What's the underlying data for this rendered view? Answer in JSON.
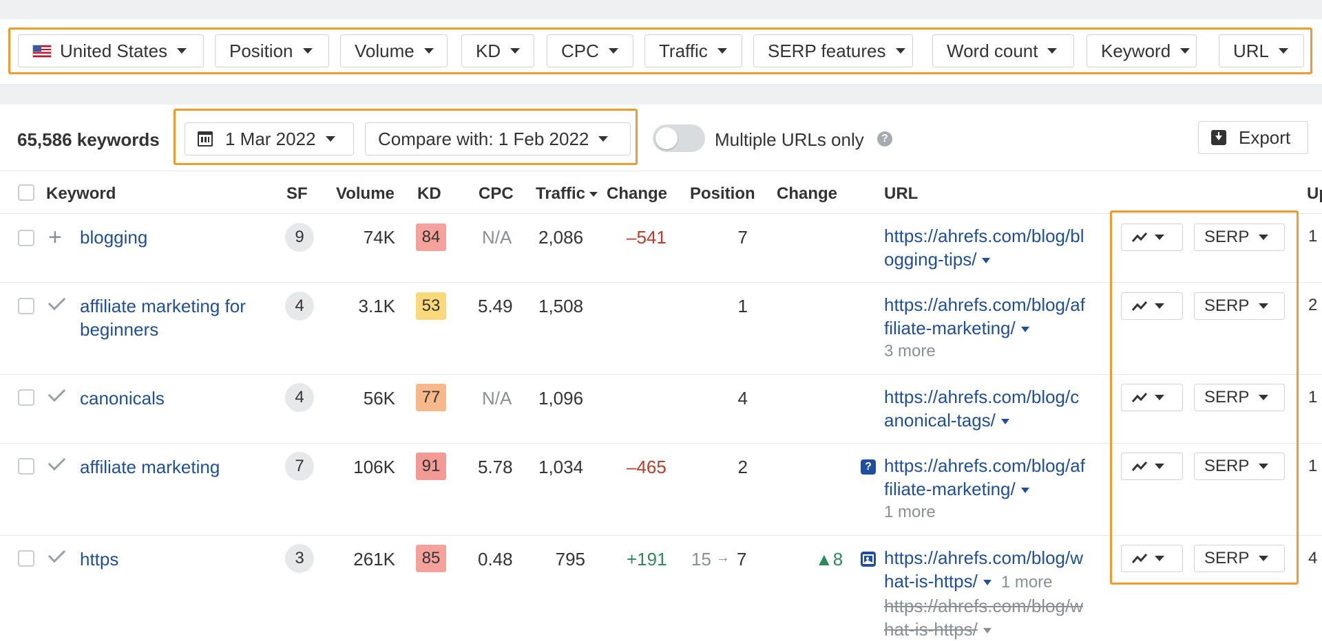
{
  "filters": {
    "country": "United States",
    "items": [
      "Position",
      "Volume",
      "KD",
      "CPC",
      "Traffic",
      "SERP features",
      "Word count",
      "Keyword",
      "URL"
    ]
  },
  "toolbar": {
    "keyword_count": "65,586 keywords",
    "date": "1 Mar 2022",
    "compare": "Compare with: 1 Feb 2022",
    "multiple_urls_label": "Multiple URLs only",
    "help": "?",
    "export_label": "Export"
  },
  "columns": {
    "keyword": "Keyword",
    "sf": "SF",
    "volume": "Volume",
    "kd": "KD",
    "cpc": "CPC",
    "traffic": "Traffic",
    "change": "Change",
    "position": "Position",
    "pos_change": "Change",
    "url": "URL",
    "up": "Up"
  },
  "rows": [
    {
      "keyword_line1": "blogging",
      "keyword_line2": "",
      "sf": "9",
      "volume": "74K",
      "kd": "84",
      "kd_color": "#f4a29b",
      "cpc": "N/A",
      "traffic": "2,086",
      "change": "–541",
      "position": "7",
      "pos_change": "",
      "url_line1": "https://ahrefs.com/blog/bl",
      "url_line2": "ogging-tips/",
      "more": "",
      "action_trend_icon": "trend-icon",
      "serp_label": "SERP",
      "up": "1"
    },
    {
      "keyword_line1": "affiliate marketing for",
      "keyword_line2": "beginners",
      "sf": "4",
      "volume": "3.1K",
      "kd": "53",
      "kd_color": "#fbd97a",
      "cpc": "5.49",
      "traffic": "1,508",
      "change": "",
      "position": "1",
      "pos_change": "",
      "url_line1": "https://ahrefs.com/blog/af",
      "url_line2": "filiate-marketing/",
      "more": "3 more",
      "action_trend_icon": "trend-icon",
      "serp_label": "SERP",
      "up": "2"
    },
    {
      "keyword_line1": "canonicals",
      "keyword_line2": "",
      "sf": "4",
      "volume": "56K",
      "kd": "77",
      "kd_color": "#f7b98a",
      "cpc": "N/A",
      "traffic": "1,096",
      "change": "",
      "position": "4",
      "pos_change": "",
      "url_line1": "https://ahrefs.com/blog/c",
      "url_line2": "anonical-tags/",
      "more": "",
      "action_trend_icon": "trend-icon",
      "serp_label": "SERP",
      "up": "1"
    },
    {
      "keyword_line1": "affiliate marketing",
      "keyword_line2": "",
      "sf": "7",
      "volume": "106K",
      "kd": "91",
      "kd_color": "#f29a93",
      "cpc": "5.78",
      "traffic": "1,034",
      "change": "–465",
      "position": "2",
      "pos_change": "",
      "url_line1": "https://ahrefs.com/blog/af",
      "url_line2": "filiate-marketing/",
      "more": "1 more",
      "action_trend_icon": "trend-icon",
      "serp_label": "SERP",
      "up": "1"
    },
    {
      "keyword_line1": "https",
      "keyword_line2": "",
      "sf": "3",
      "volume": "261K",
      "kd": "85",
      "kd_color": "#f4a29b",
      "cpc": "0.48",
      "traffic": "795",
      "change": "+191",
      "position_prev": "15",
      "position_arrow": "→",
      "position": "7",
      "pos_change": "▲8",
      "url_line1": "https://ahrefs.com/blog/w",
      "url_line2": "hat-is-https/",
      "more": "1 more",
      "old_url_line1": "https://ahrefs.com/blog/w",
      "old_url_line2": "hat-is-https/",
      "action_trend_icon": "trend-icon",
      "serp_label": "SERP",
      "up": "4"
    }
  ],
  "serp_feature_icons": {
    "row4": "?",
    "row5": "image-icon"
  },
  "accent_colors": {
    "highlight": "#f29a2e",
    "link": "#1f4e9c",
    "negative": "#c0392b",
    "positive": "#2e8b57"
  }
}
